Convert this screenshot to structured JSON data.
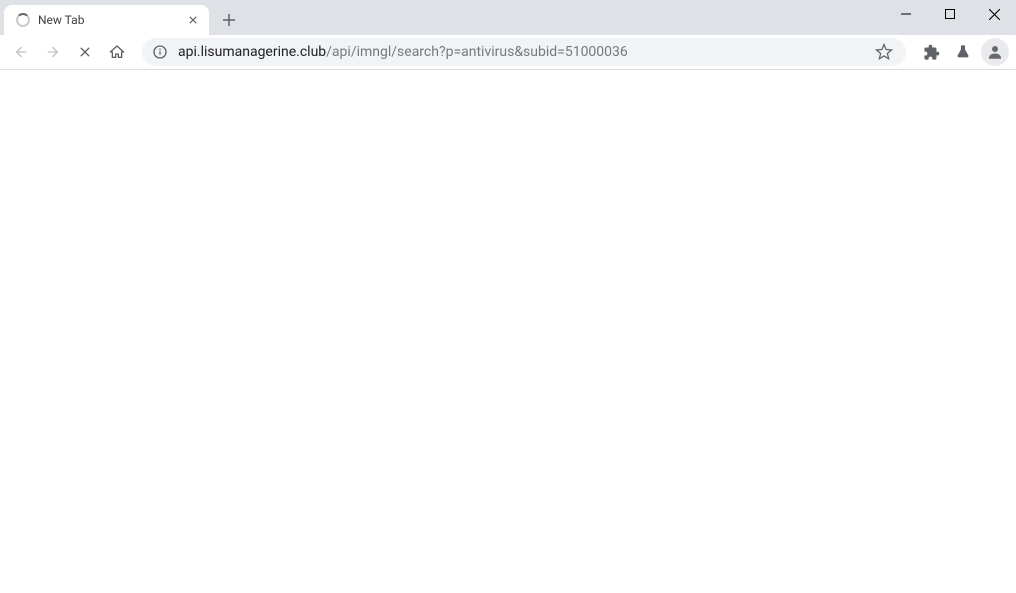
{
  "tab": {
    "title": "New Tab",
    "loading": true
  },
  "url": {
    "host": "api.lisumanagerine.club",
    "path": "/api/imngl/search?p=antivirus&subid=51000036"
  },
  "nav": {
    "back_enabled": false,
    "forward_enabled": false
  }
}
